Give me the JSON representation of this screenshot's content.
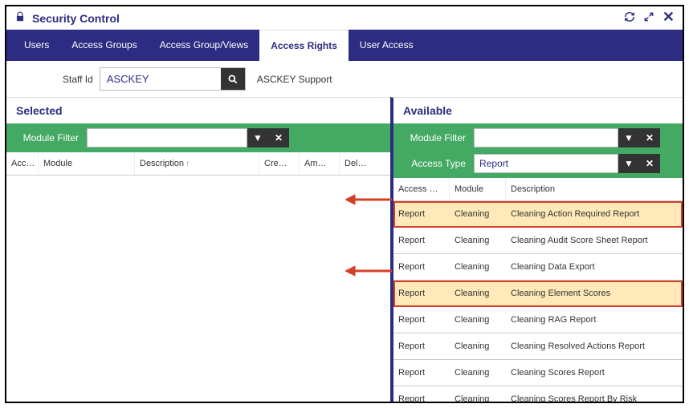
{
  "window_title": "Security Control",
  "tabs": [
    "Users",
    "Access Groups",
    "Access Group/Views",
    "Access Rights",
    "User Access"
  ],
  "active_tab": 3,
  "staff": {
    "label": "Staff Id",
    "value": "ASCKEY",
    "display_name": "ASCKEY  Support"
  },
  "left": {
    "title": "Selected",
    "filter_label": "Module Filter",
    "filter_value": "",
    "columns": [
      "Acc…",
      "Module",
      "Description",
      "Cre…",
      "Am…",
      "Del…"
    ],
    "sort_col": 2
  },
  "right": {
    "title": "Available",
    "filter_label": "Module Filter",
    "filter_value": "",
    "access_type_label": "Access Type",
    "access_type_value": "Report",
    "columns": [
      "Access …",
      "Module",
      "Description"
    ],
    "rows": [
      {
        "access": "Report",
        "module": "Cleaning",
        "desc": "Cleaning Action Required Report",
        "hl": true
      },
      {
        "access": "Report",
        "module": "Cleaning",
        "desc": "Cleaning Audit Score Sheet Report",
        "hl": false
      },
      {
        "access": "Report",
        "module": "Cleaning",
        "desc": "Cleaning Data Export",
        "hl": false
      },
      {
        "access": "Report",
        "module": "Cleaning",
        "desc": "Cleaning Element Scores",
        "hl": true
      },
      {
        "access": "Report",
        "module": "Cleaning",
        "desc": "Cleaning RAG Report",
        "hl": false
      },
      {
        "access": "Report",
        "module": "Cleaning",
        "desc": "Cleaning Resolved Actions Report",
        "hl": false
      },
      {
        "access": "Report",
        "module": "Cleaning",
        "desc": "Cleaning Scores Report",
        "hl": false
      },
      {
        "access": "Report",
        "module": "Cleaning",
        "desc": "Cleaning Scores Report By Risk",
        "hl": false
      }
    ]
  }
}
